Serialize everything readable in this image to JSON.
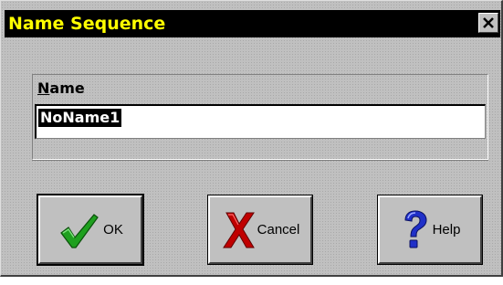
{
  "window": {
    "title": "Name Sequence",
    "close_symbol": "✕"
  },
  "form": {
    "name_label": "Name",
    "name_mnemonic": "N",
    "name_rest": "ame",
    "name_value": "NoName1"
  },
  "buttons": {
    "ok_label": "OK",
    "cancel_label": "Cancel",
    "help_label": "Help"
  },
  "icons": {
    "ok": "checkmark-icon",
    "cancel": "x-cross-icon",
    "help": "question-mark-icon",
    "close": "close-icon"
  },
  "colors": {
    "title_bar": "#000000",
    "title_text": "#ffff00",
    "dialog_bg": "#c0c0c0",
    "check_green": "#1fa01f",
    "cross_red": "#c00000",
    "help_blue": "#2030c8"
  }
}
